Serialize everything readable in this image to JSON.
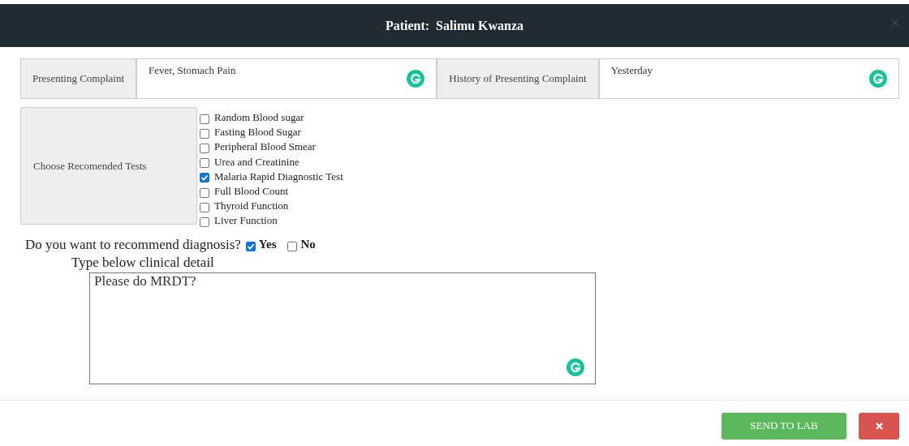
{
  "modal": {
    "title": "Patient:  Salimu Kwanza"
  },
  "fields": [
    {
      "label": "Presenting Complaint",
      "value": "Fever, Stomach Pain"
    },
    {
      "label": "History of Presenting Complaint",
      "value": "Yesterday"
    }
  ],
  "tests": {
    "label": "Choose Recomended Tests",
    "items": [
      {
        "label": "Random Blood sugar",
        "checked": false
      },
      {
        "label": "Fasting Blood Sugar",
        "checked": false
      },
      {
        "label": "Peripheral Blood Smear",
        "checked": false
      },
      {
        "label": "Urea and Creatinine",
        "checked": false
      },
      {
        "label": "Malaria Rapid Diagnostic Test",
        "checked": true
      },
      {
        "label": "Full Blood Count",
        "checked": false
      },
      {
        "label": "Thyroid Function",
        "checked": false
      },
      {
        "label": "Liver Function",
        "checked": false
      }
    ]
  },
  "question": {
    "text": "Do you want to recommend diagnosis?",
    "options": [
      {
        "label": "Yes",
        "selected": true
      },
      {
        "label": "No",
        "selected": false
      }
    ]
  },
  "clinical_detail": {
    "label": "Type below clinical detail",
    "value": "Please do MRDT?"
  },
  "buttons": [
    {
      "kind": "primary",
      "label": "SEND TO LAB"
    },
    {
      "kind": "close"
    }
  ]
}
